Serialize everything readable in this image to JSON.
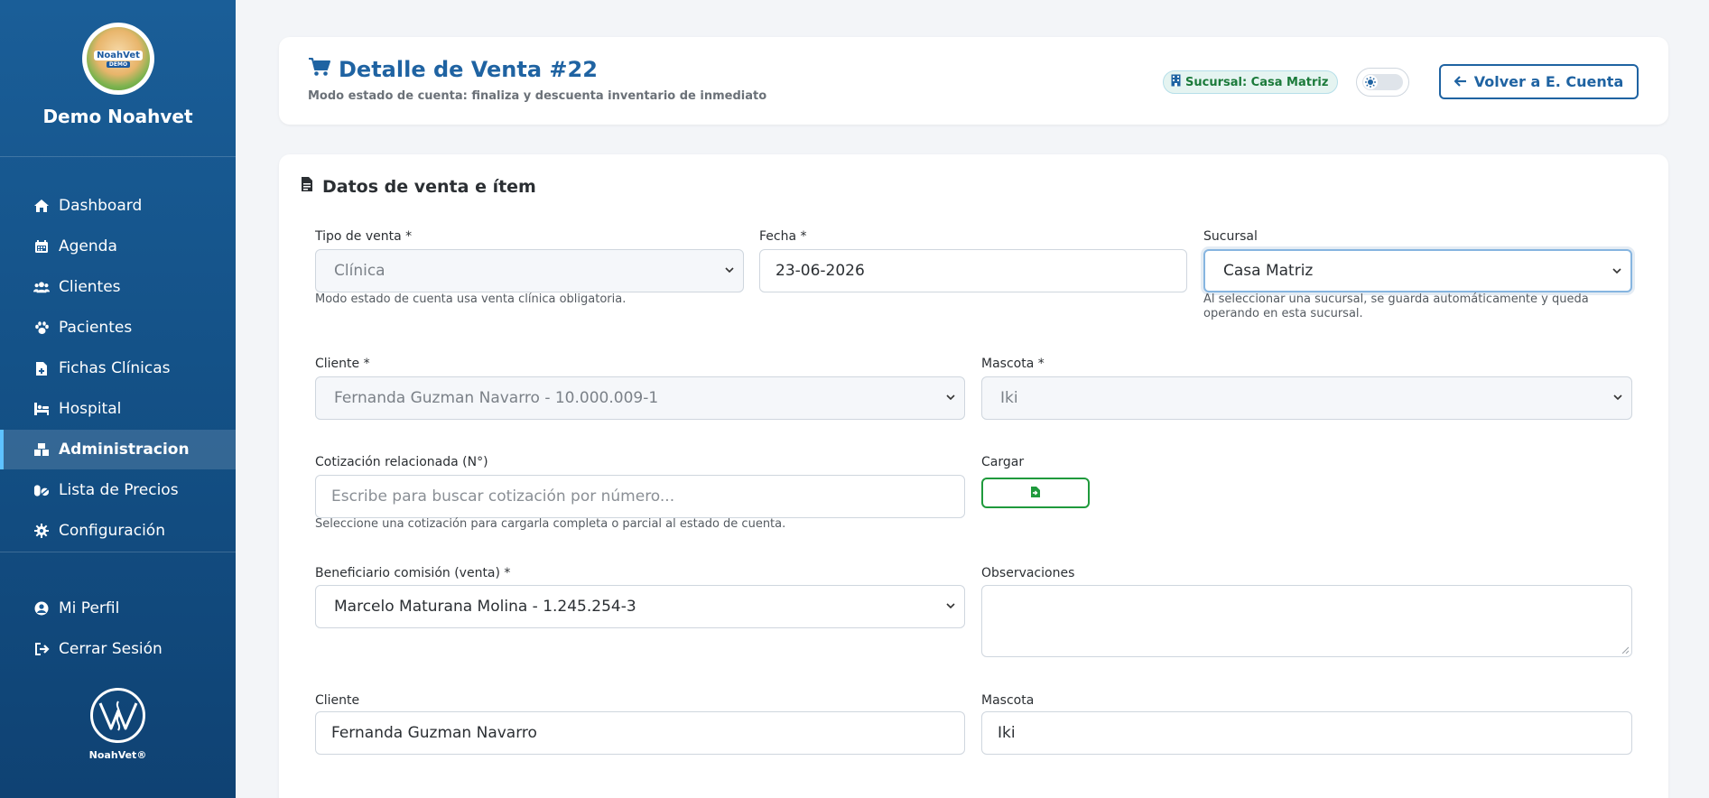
{
  "sidebar": {
    "brand": "Demo Noahvet",
    "logo_text": "NoahVet",
    "logo_sub": "DEMO",
    "items": [
      {
        "label": "Dashboard",
        "icon": "home-icon"
      },
      {
        "label": "Agenda",
        "icon": "calendar-icon"
      },
      {
        "label": "Clientes",
        "icon": "users-icon"
      },
      {
        "label": "Pacientes",
        "icon": "paw-icon"
      },
      {
        "label": "Fichas Clínicas",
        "icon": "file-medical-icon"
      },
      {
        "label": "Hospital",
        "icon": "hospital-icon"
      },
      {
        "label": "Administracion",
        "icon": "boxes-icon",
        "active": true
      },
      {
        "label": "Lista de Precios",
        "icon": "pills-icon"
      },
      {
        "label": "Configuración",
        "icon": "gear-icon"
      }
    ],
    "profile": {
      "label": "Mi Perfil",
      "icon": "user-circle-icon"
    },
    "logout": {
      "label": "Cerrar Sesión",
      "icon": "logout-icon"
    },
    "footer_text": "NoahVet®"
  },
  "header": {
    "title": "Detalle de Venta #22",
    "subtitle": "Modo estado de cuenta: finaliza y descuenta inventario de inmediato",
    "branch_badge": "Sucursal: Casa Matriz",
    "back_button": "Volver a E. Cuenta"
  },
  "form": {
    "section_title": "Datos de venta e ítem",
    "tipo_venta": {
      "label": "Tipo de venta *",
      "value": "Clínica",
      "help": "Modo estado de cuenta usa venta clínica obligatoria."
    },
    "fecha": {
      "label": "Fecha *",
      "value": "23-06-2026"
    },
    "sucursal": {
      "label": "Sucursal",
      "value": "Casa Matriz",
      "help": "Al seleccionar una sucursal, se guarda automáticamente y queda operando en esta sucursal."
    },
    "cliente_select": {
      "label": "Cliente *",
      "value": "Fernanda Guzman Navarro - 10.000.009-1"
    },
    "mascota_select": {
      "label": "Mascota *",
      "value": "Iki"
    },
    "cotizacion": {
      "label": "Cotización relacionada (N°)",
      "placeholder": "Escribe para buscar cotización por número...",
      "help": "Seleccione una cotización para cargarla completa o parcial al estado de cuenta."
    },
    "cargar": {
      "label": "Cargar"
    },
    "beneficiario": {
      "label": "Beneficiario comisión (venta) *",
      "value": "Marcelo Maturana Molina - 1.245.254-3"
    },
    "observaciones": {
      "label": "Observaciones",
      "value": ""
    },
    "cliente_text": {
      "label": "Cliente",
      "value": "Fernanda Guzman Navarro"
    },
    "mascota_text": {
      "label": "Mascota",
      "value": "Iki"
    }
  },
  "colors": {
    "primary": "#1f63a2",
    "sidebar_top": "#1a5e98",
    "sidebar_bottom": "#0f4273",
    "success": "#1f9a3c",
    "page_bg": "#f3f5f8"
  }
}
